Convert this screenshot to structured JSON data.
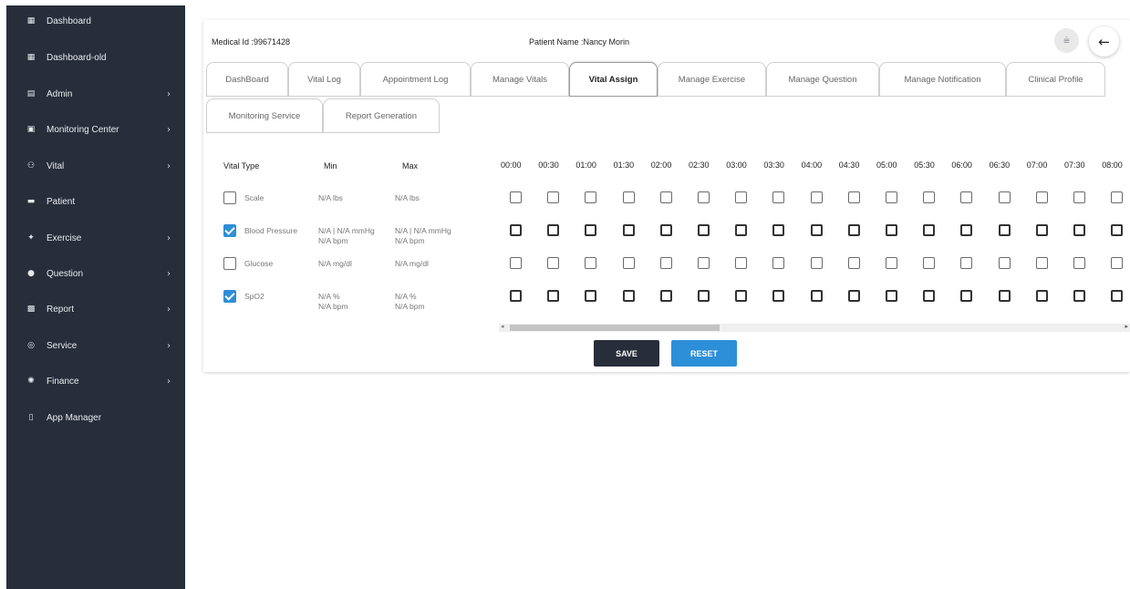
{
  "sidebar": {
    "items": [
      {
        "label": "Dashboard",
        "icon": "grid-icon",
        "glyph": "▦",
        "has_chevron": false
      },
      {
        "label": "Dashboard-old",
        "icon": "grid-icon",
        "glyph": "▦",
        "has_chevron": false
      },
      {
        "label": "Admin",
        "icon": "table-icon",
        "glyph": "▤",
        "has_chevron": true
      },
      {
        "label": "Monitoring Center",
        "icon": "building-icon",
        "glyph": "▣",
        "has_chevron": true
      },
      {
        "label": "Vital",
        "icon": "users-icon",
        "glyph": "⚇",
        "has_chevron": true
      },
      {
        "label": "Patient",
        "icon": "bed-icon",
        "glyph": "▬",
        "has_chevron": false
      },
      {
        "label": "Exercise",
        "icon": "run-icon",
        "glyph": "✦",
        "has_chevron": true
      },
      {
        "label": "Question",
        "icon": "question-icon",
        "glyph": "●",
        "has_chevron": true
      },
      {
        "label": "Report",
        "icon": "report-icon",
        "glyph": "▩",
        "has_chevron": true
      },
      {
        "label": "Service",
        "icon": "service-icon",
        "glyph": "◎",
        "has_chevron": true
      },
      {
        "label": "Finance",
        "icon": "finance-icon",
        "glyph": "✺",
        "has_chevron": true
      },
      {
        "label": "App Manager",
        "icon": "mobile-icon",
        "glyph": "▯",
        "has_chevron": false
      }
    ]
  },
  "header": {
    "medical_id": "Medical Id :99671428",
    "patient_name": "Patient Name :Nancy Morin"
  },
  "tabs": [
    {
      "label": "DashBoard",
      "active": false
    },
    {
      "label": "Vital Log",
      "active": false
    },
    {
      "label": "Appointment Log",
      "active": false
    },
    {
      "label": "Manage Vitals",
      "active": false
    },
    {
      "label": "Vital Assign",
      "active": true
    },
    {
      "label": "Manage Exercise",
      "active": false
    },
    {
      "label": "Manage Question",
      "active": false
    },
    {
      "label": "Manage Notification",
      "active": false
    },
    {
      "label": "Clinical Profile",
      "active": false
    },
    {
      "label": "Monitoring Service",
      "active": false
    },
    {
      "label": "Report Generation",
      "active": false
    }
  ],
  "vital_table": {
    "headers": {
      "type": "Vital Type",
      "min": "Min",
      "max": "Max"
    },
    "rows": [
      {
        "name": "Scale",
        "checked": false,
        "min": "N/A lbs",
        "max": "N/A lbs",
        "bold_slots": false
      },
      {
        "name": "Blood Pressure",
        "checked": true,
        "min": "N/A | N/A mmHg\nN/A bpm",
        "max": "N/A | N/A mmHg\nN/A bpm",
        "bold_slots": true
      },
      {
        "name": "Glucose",
        "checked": false,
        "min": "N/A mg/dl",
        "max": "N/A mg/dl",
        "bold_slots": false
      },
      {
        "name": "SpO2",
        "checked": true,
        "min": "N/A %\nN/A bpm",
        "max": "N/A %\nN/A bpm",
        "bold_slots": true
      }
    ],
    "times": [
      "00:00",
      "00:30",
      "01:00",
      "01:30",
      "02:00",
      "02:30",
      "03:00",
      "03:30",
      "04:00",
      "04:30",
      "05:00",
      "05:30",
      "06:00",
      "06:30",
      "07:00",
      "07:30",
      "08:00"
    ]
  },
  "buttons": {
    "save": "SAVE",
    "reset": "RESET"
  },
  "icons": {
    "filter": "filter-icon",
    "back": "arrow-left-icon"
  },
  "colors": {
    "sidebar_bg": "#272e3a",
    "accent": "#2d8fd7",
    "save_bg": "#272e3a"
  }
}
